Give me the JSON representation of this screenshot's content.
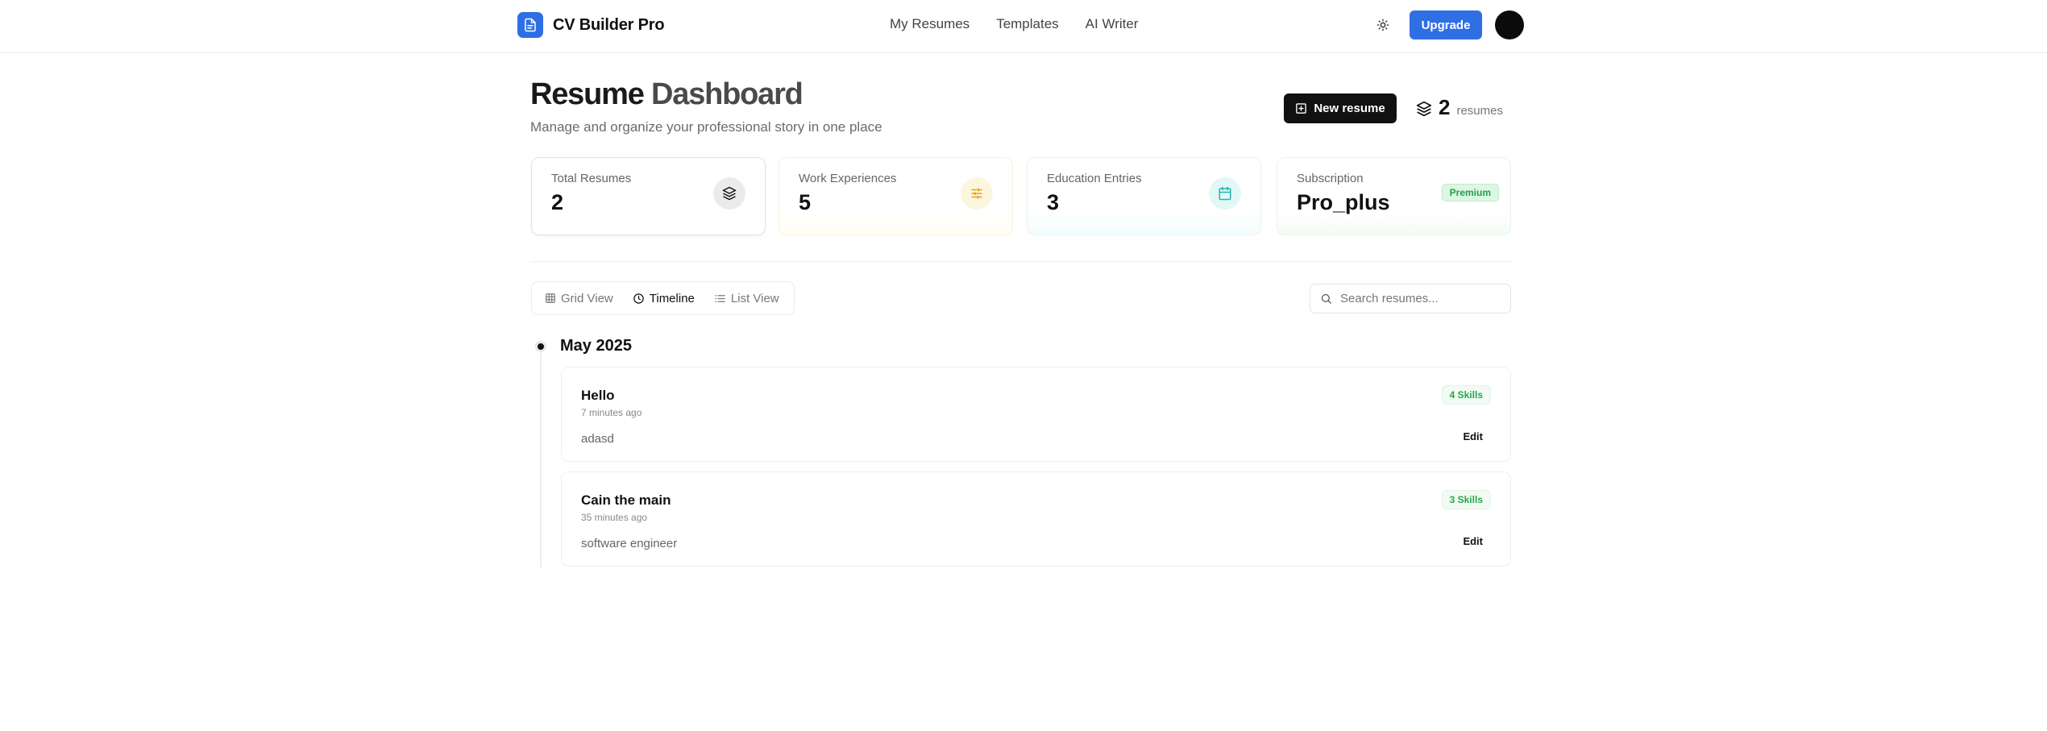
{
  "nav": {
    "brand": "CV Builder Pro",
    "links": [
      "My Resumes",
      "Templates",
      "AI Writer"
    ],
    "upgrade_label": "Upgrade"
  },
  "header": {
    "title_part1": "Resume",
    "title_part2": "Dashboard",
    "subtitle": "Manage and organize your professional story in one place",
    "new_resume_label": "New resume",
    "resume_count": "2",
    "resume_count_label": "resumes"
  },
  "stats": [
    {
      "label": "Total Resumes",
      "value": "2",
      "icon": "layers-icon"
    },
    {
      "label": "Work Experiences",
      "value": "5",
      "icon": "sliders-icon"
    },
    {
      "label": "Education Entries",
      "value": "3",
      "icon": "calendar-icon"
    },
    {
      "label": "Subscription",
      "value": "Pro_plus",
      "badge": "Premium"
    }
  ],
  "views": {
    "tabs": [
      "Grid View",
      "Timeline",
      "List View"
    ],
    "active": "Timeline"
  },
  "search": {
    "placeholder": "Search resumes..."
  },
  "timeline": {
    "group_label": "May 2025",
    "resumes": [
      {
        "title": "Hello",
        "time": "7 minutes ago",
        "description": "adasd",
        "skills": "4 Skills",
        "edit_label": "Edit"
      },
      {
        "title": "Cain the main",
        "time": "35 minutes ago",
        "description": "software engineer",
        "skills": "3 Skills",
        "edit_label": "Edit"
      }
    ]
  },
  "colors": {
    "brand_blue": "#2f6fe4",
    "premium_green": "#22a04a",
    "experience_amber": "#e7a21b",
    "education_teal": "#1fb5b0"
  }
}
